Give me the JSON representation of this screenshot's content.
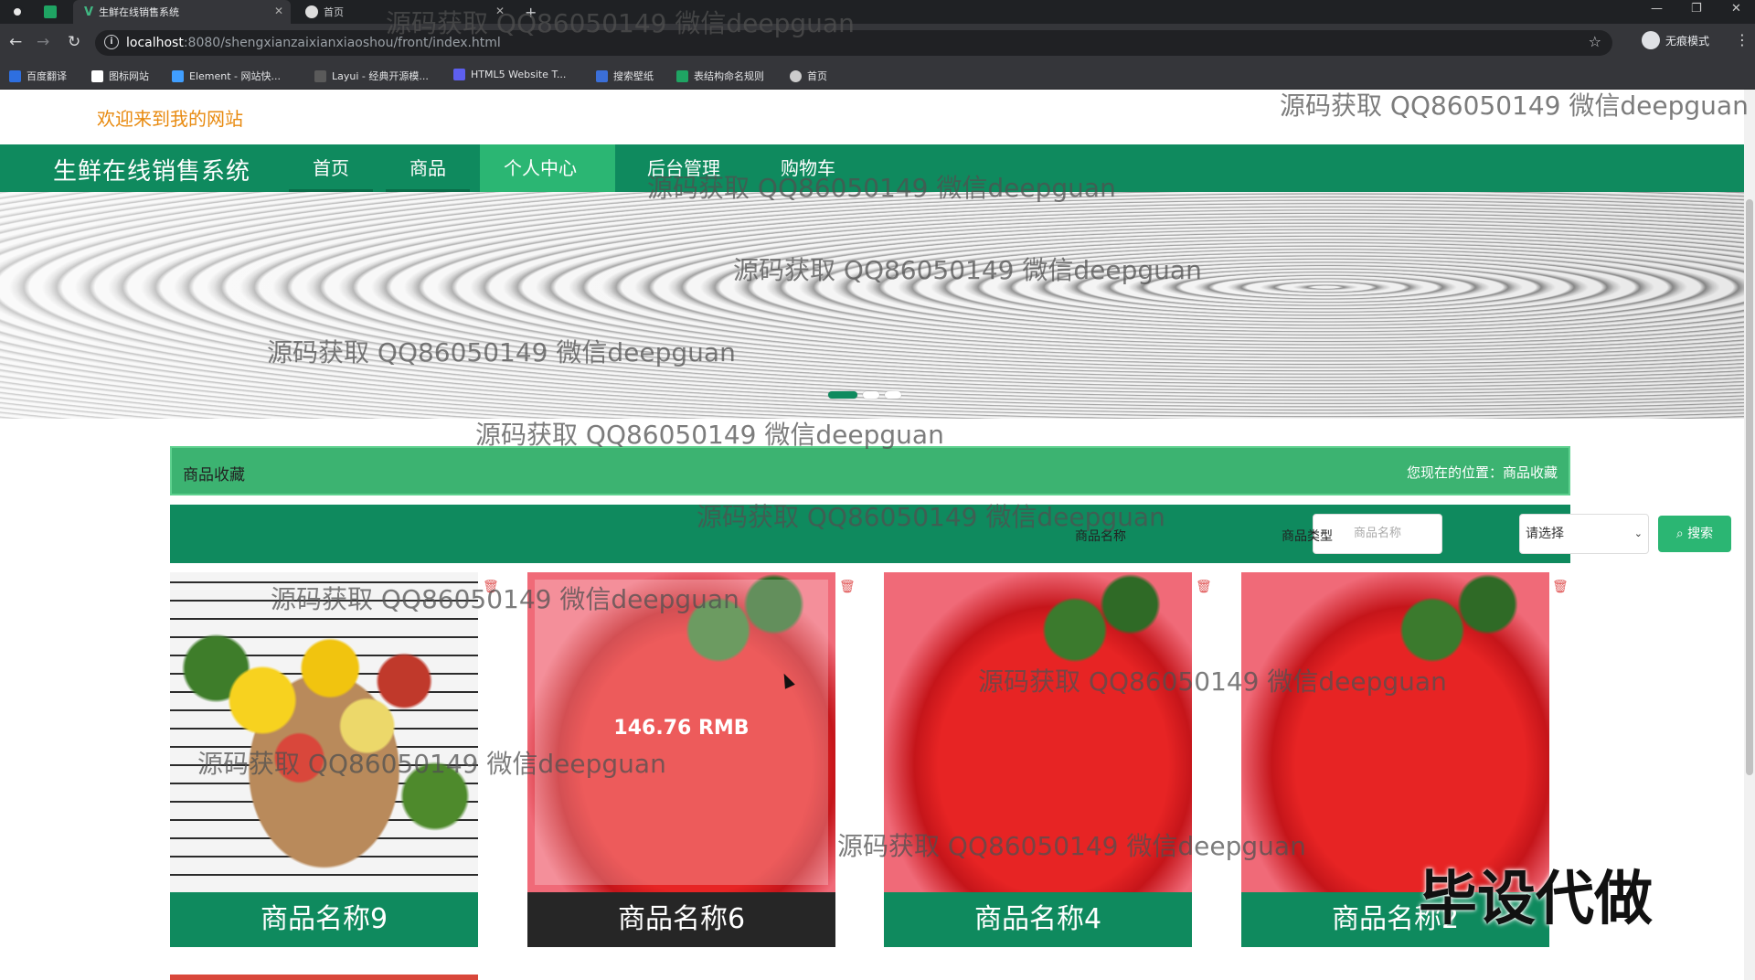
{
  "browser": {
    "tabs": [
      {
        "title": ""
      },
      {
        "title": ""
      },
      {
        "title": "生鲜在线销售系统"
      },
      {
        "title": "首页"
      }
    ],
    "url_host": "localhost",
    "url_path": ":8080/shengxianzaixianxiaoshou/front/index.html",
    "profile_label": "无痕模式",
    "bookmarks": [
      "百度翻译",
      "图标网站",
      "Element - 网站快...",
      "Layui - 经典开源模...",
      "HTML5 Website T...",
      "搜索壁纸",
      "表结构命名规则",
      "首页"
    ]
  },
  "page": {
    "welcome": "欢迎来到我的网站",
    "brand": "生鲜在线销售系统",
    "nav": [
      "首页",
      "商品",
      "个人中心",
      "后台管理",
      "购物车"
    ],
    "active_nav": "个人中心",
    "banner_dots": 3,
    "section_title": "商品收藏",
    "location": "您现在的位置：商品收藏",
    "search": {
      "name_label": "商品名称",
      "name_placeholder": "商品名称",
      "type_label": "商品类型",
      "type_selected": "请选择",
      "button": "搜索"
    },
    "products": [
      {
        "name": "商品名称9",
        "image": "fruit-basket"
      },
      {
        "name": "商品名称6",
        "image": "strawberry",
        "hover_price": "146.76 RMB"
      },
      {
        "name": "商品名称4",
        "image": "strawberry"
      },
      {
        "name": "商品名称2",
        "image": "strawberry"
      }
    ]
  },
  "overlays": {
    "watermark": "源码获取 QQ86050149 微信deepguan",
    "stamp": "毕设代做"
  },
  "colors": {
    "primary": "#0f8a5e",
    "accent": "#2bb673",
    "breadcrumb": "#3cb371",
    "welcome": "#e88a0f"
  }
}
